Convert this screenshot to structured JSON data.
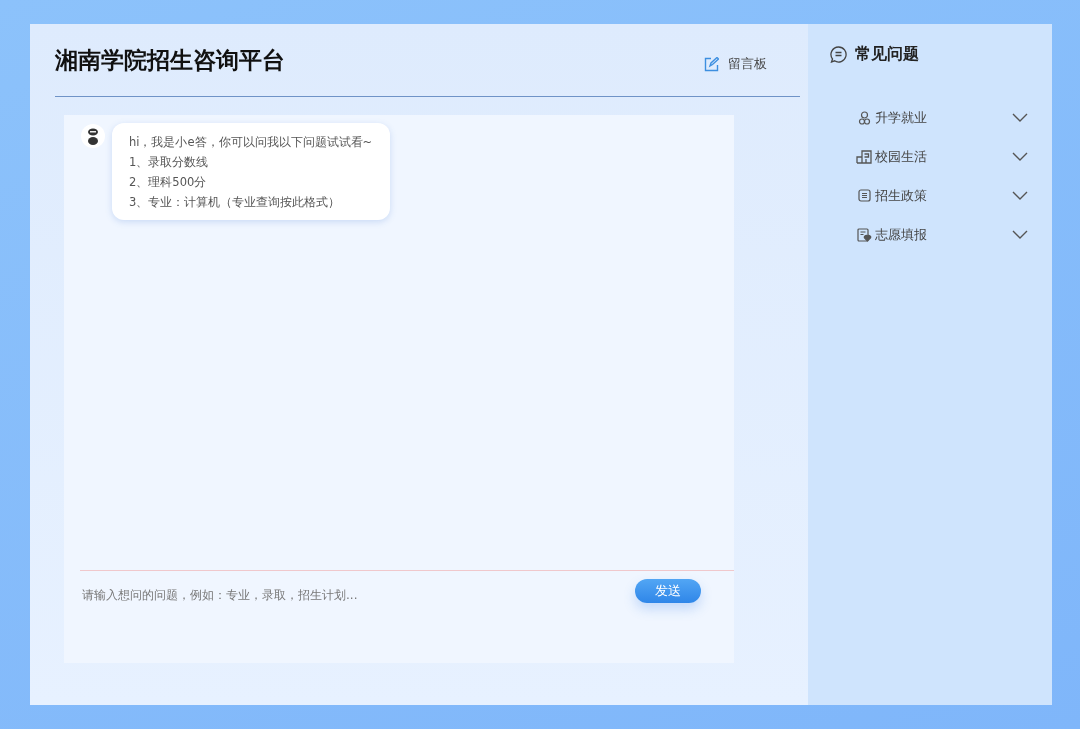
{
  "header": {
    "title": "湘南学院招生咨询平台",
    "message_board_link": "留言板"
  },
  "chat": {
    "messages": [
      {
        "lines": [
          "hi，我是小e答，你可以问我以下问题试试看~",
          "1、录取分数线",
          "2、理科500分",
          "3、专业：计算机（专业查询按此格式）"
        ]
      }
    ],
    "input": {
      "placeholder": "请输入想问的问题，例如：专业，录取，招生计划..."
    },
    "send_button": "发送"
  },
  "sidebar": {
    "title": "常见问题",
    "items": [
      {
        "label": "升学就业",
        "expanded": false
      },
      {
        "label": "校园生活",
        "expanded": false
      },
      {
        "label": "招生政策",
        "expanded": false
      },
      {
        "label": "志愿填报",
        "expanded": false
      }
    ]
  }
}
